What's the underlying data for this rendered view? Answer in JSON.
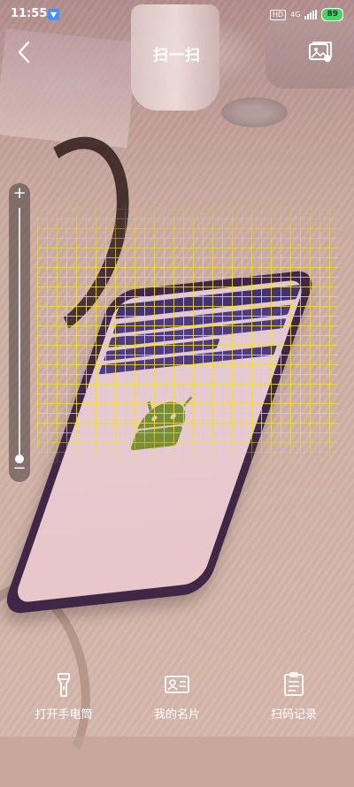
{
  "status_bar": {
    "time": "11:55",
    "hd": "HD",
    "network": "4G",
    "battery": "89"
  },
  "header": {
    "title": "扫一扫"
  },
  "zoom": {
    "plus": "+",
    "minus": "−",
    "level": 0.0
  },
  "bottom": {
    "items": [
      {
        "label": "打开手电筒",
        "icon": "flashlight-icon"
      },
      {
        "label": "我的名片",
        "icon": "card-icon"
      },
      {
        "label": "扫码记录",
        "icon": "history-icon"
      }
    ]
  },
  "colors": {
    "grid": "#f0dc3c",
    "battery": "#4ad36a"
  }
}
